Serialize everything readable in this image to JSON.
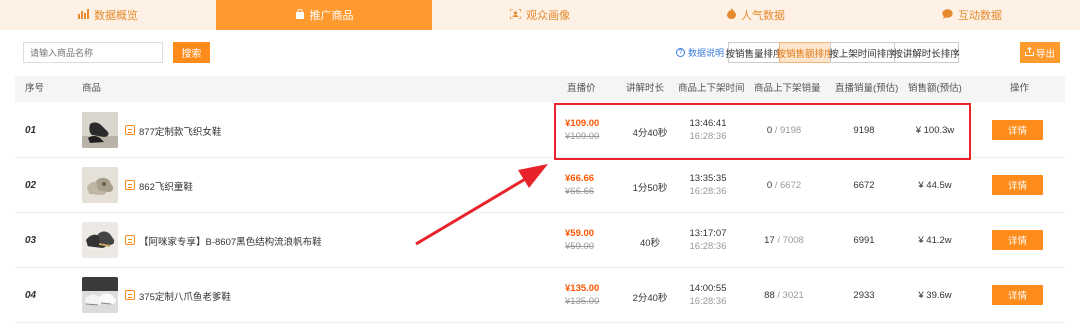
{
  "tabs": [
    {
      "label": "数据概览",
      "icon": "bar-chart-icon",
      "active": false
    },
    {
      "label": "推广商品",
      "icon": "shopping-bag-icon",
      "active": true
    },
    {
      "label": "观众画像",
      "icon": "portrait-icon",
      "active": false
    },
    {
      "label": "人气数据",
      "icon": "flame-icon",
      "active": false
    },
    {
      "label": "互动数据",
      "icon": "chat-icon",
      "active": false
    }
  ],
  "toolbar": {
    "search_placeholder": "请输入商品名称",
    "search_label": "搜索",
    "help_label": "数据说明",
    "sort_options": [
      "按销售量排序",
      "按销售额排序",
      "按上架时间排序",
      "按讲解时长排序"
    ],
    "active_sort": 1,
    "export_label": "导出"
  },
  "table": {
    "headers": [
      "序号",
      "商品",
      "直播价",
      "讲解时长",
      "商品上下架时间",
      "商品上下架销量",
      "直播销量(预估)",
      "销售额(预估)",
      "操作"
    ],
    "rows": [
      {
        "index": "01",
        "name": "877定制款飞织女鞋",
        "price": "¥109.00",
        "original": "¥109.00",
        "duration": "4分40秒",
        "on_time": "13:46:41",
        "off_time": "16:28:36",
        "sold": "0",
        "sold_total": "/ 9198",
        "live_sales": "9198",
        "revenue": "¥ 100.3w",
        "action": "详情"
      },
      {
        "index": "02",
        "name": "862飞织童鞋",
        "price": "¥66.66",
        "original": "¥66.66",
        "duration": "1分50秒",
        "on_time": "13:35:35",
        "off_time": "16:28:36",
        "sold": "0",
        "sold_total": "/ 6672",
        "live_sales": "6672",
        "revenue": "¥ 44.5w",
        "action": "详情"
      },
      {
        "index": "03",
        "name": "【阿咪家专享】B-8607黑色结构流浪帆布鞋",
        "price": "¥59.00",
        "original": "¥59.00",
        "duration": "40秒",
        "on_time": "13:17:07",
        "off_time": "16:28:36",
        "sold": "17",
        "sold_total": "/ 7008",
        "live_sales": "6991",
        "revenue": "¥ 41.2w",
        "action": "详情"
      },
      {
        "index": "04",
        "name": "375定制八爪鱼老爹鞋",
        "price": "¥135.00",
        "original": "¥135.00",
        "duration": "2分40秒",
        "on_time": "14:00:55",
        "off_time": "16:28:36",
        "sold": "88",
        "sold_total": "/ 3021",
        "live_sales": "2933",
        "revenue": "¥ 39.6w",
        "action": "详情"
      }
    ]
  },
  "colors": {
    "accent": "#ff8c1a",
    "price": "#ff5500",
    "highlight": "#e8232b",
    "link": "#3a7de0"
  }
}
